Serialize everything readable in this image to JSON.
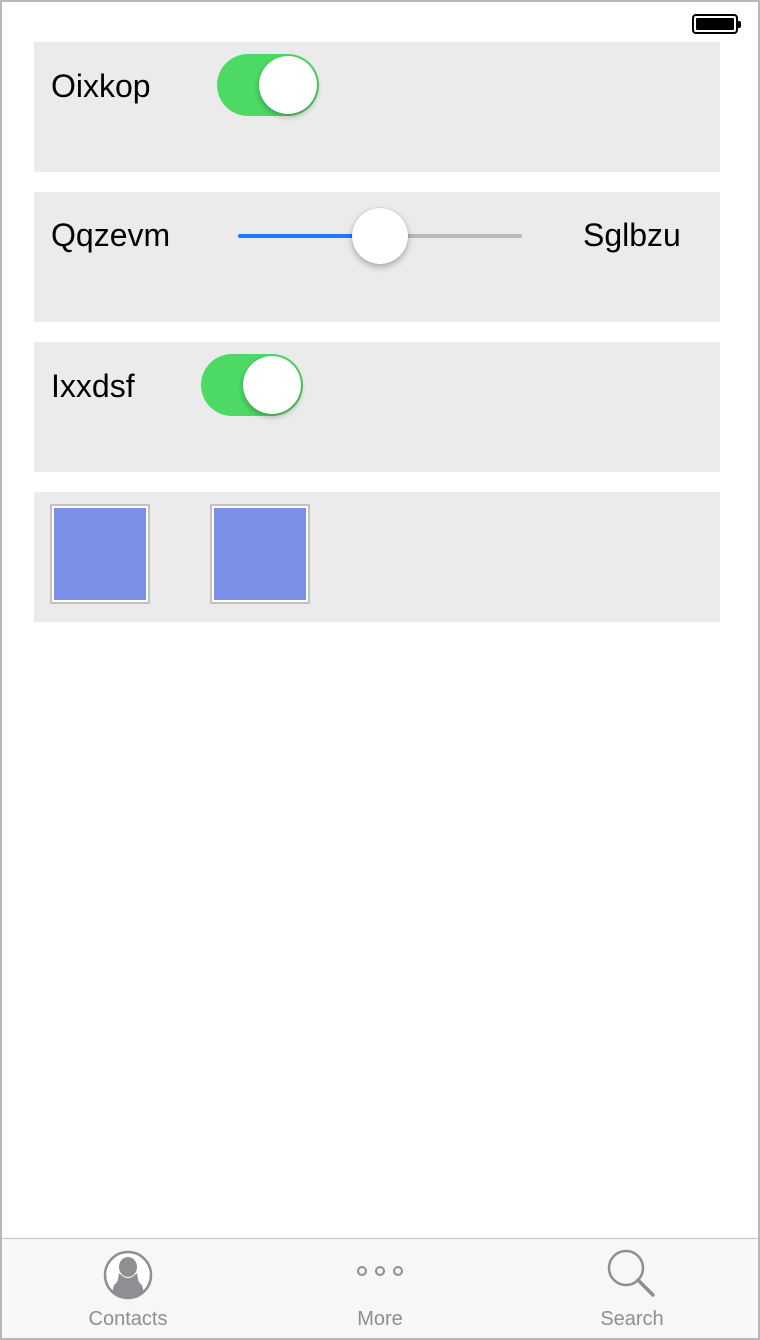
{
  "rows": [
    {
      "type": "toggle",
      "label": "Oixkop",
      "on": true
    },
    {
      "type": "slider",
      "label": "Qqzevm",
      "end_label": "Sglbzu",
      "value_percent": 50
    },
    {
      "type": "toggle",
      "label": "Ixxdsf",
      "on": true
    },
    {
      "type": "images",
      "count": 2
    }
  ],
  "tabbar": {
    "tabs": [
      {
        "label": "Contacts",
        "icon": "person-icon"
      },
      {
        "label": "More",
        "icon": "more-dots-icon"
      },
      {
        "label": "Search",
        "icon": "search-icon"
      }
    ]
  },
  "colors": {
    "toggle_on": "#4cd964",
    "slider_fill": "#1e78ff",
    "tile_fill": "#7990e6",
    "row_bg": "#ebebeb"
  }
}
